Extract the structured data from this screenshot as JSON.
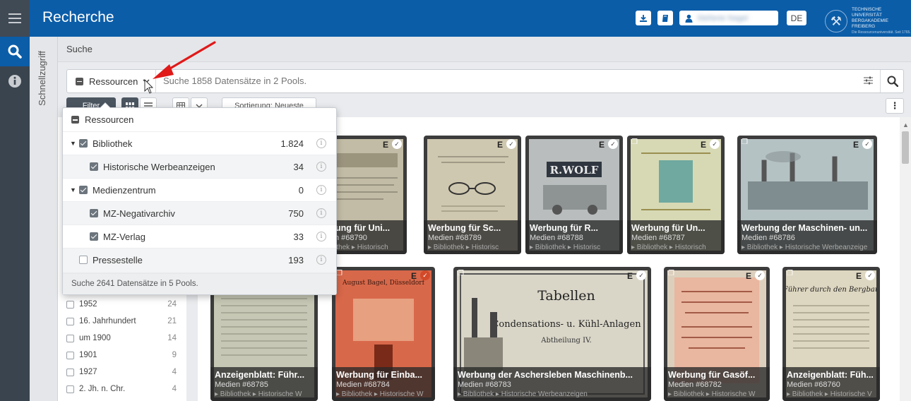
{
  "app": {
    "title": "Recherche"
  },
  "header": {
    "download_icon": "download-icon",
    "book_icon": "book-icon",
    "user_icon": "user-icon",
    "user_name": "Stefanie Nagel",
    "language": "DE",
    "university": {
      "line1": "TECHNISCHE UNIVERSITÄT",
      "line2": "BERGAKADEMIE FREIBERG",
      "line3": "Die Ressourcenuniversität. Seit 1765."
    }
  },
  "sidebar": {
    "quick_access": "Schnellzugriff"
  },
  "search": {
    "section_title": "Suche",
    "resource_label": "Ressourcen",
    "placeholder": "Suche 1858 Datensätze in 2 Pools.",
    "sort_label": "Sortierung: Neueste",
    "filter_label": "Filter"
  },
  "dropdown": {
    "header": "Ressourcen",
    "items": [
      {
        "label": "Bibliothek",
        "count": "1.824",
        "checked": true,
        "expandable": true,
        "level": 0
      },
      {
        "label": "Historische Werbeanzeigen",
        "count": "34",
        "checked": true,
        "expandable": false,
        "level": 1
      },
      {
        "label": "Medienzentrum",
        "count": "0",
        "checked": true,
        "expandable": true,
        "level": 0
      },
      {
        "label": "MZ-Negativarchiv",
        "count": "750",
        "checked": true,
        "expandable": false,
        "level": 1
      },
      {
        "label": "MZ-Verlag",
        "count": "33",
        "checked": true,
        "expandable": false,
        "level": 1
      },
      {
        "label": "Pressestelle",
        "count": "193",
        "checked": false,
        "expandable": false,
        "level": 0
      }
    ],
    "footer": "Suche 2641 Datensätze in 5 Pools."
  },
  "filters": {
    "items": [
      {
        "label": "1952",
        "count": "24"
      },
      {
        "label": "16. Jahrhundert",
        "count": "21"
      },
      {
        "label": "um 1900",
        "count": "14"
      },
      {
        "label": "1901",
        "count": "9"
      },
      {
        "label": "1927",
        "count": "4"
      },
      {
        "label": "2. Jh. n. Chr.",
        "count": "4"
      }
    ]
  },
  "cards_row1": [
    {
      "title": "Werbung für Uni...",
      "sub": "Medien #68790",
      "path": "▸ Bibliothek ▸ Historisch"
    },
    {
      "title": "Werbung für Sc...",
      "sub": "Medien #68789",
      "path": "▸ Bibliothek ▸ Historisc"
    },
    {
      "title": "Werbung für R...",
      "sub": "Medien #68788",
      "path": "▸ Bibliothek ▸ Historisc"
    },
    {
      "title": "Werbung für Un...",
      "sub": "Medien #68787",
      "path": "▸ Bibliothek ▸ Historisch"
    },
    {
      "title": "Werbung der Maschinen- un...",
      "sub": "Medien #68786",
      "path": "▸ Bibliothek ▸ Historische Werbeanzeige"
    }
  ],
  "cards_row2": [
    {
      "title": "Anzeigenblatt: Führ...",
      "sub": "Medien #68785",
      "path": "▸ Bibliothek ▸ Historische W"
    },
    {
      "title": "Werbung für Einba...",
      "sub": "Medien #68784",
      "path": "▸ Bibliothek ▸ Historische W"
    },
    {
      "title": "Werbung der Aschersleben Maschinenb...",
      "sub": "Medien #68783",
      "path": "▸ Bibliothek ▸ Historische Werbeanzeigen"
    },
    {
      "title": "Werbung für Gasöf...",
      "sub": "Medien #68782",
      "path": "▸ Bibliothek ▸ Historische W"
    },
    {
      "title": "Anzeigenblatt: Füh...",
      "sub": "Medien #68760",
      "path": "▸ Bibliothek ▸ Historische V"
    }
  ],
  "card_badges": {
    "edit": "E",
    "check": "✓"
  },
  "thumb_texts": {
    "t1": "Tabellen",
    "t2": "Condensations- u. Kühl-Anlagen",
    "t3": "Abtheilung IV.",
    "t4": "R.WOLF",
    "t5": "Führer durch den Bergbau",
    "t6": "August Bagel, Düsseldorf"
  },
  "colors": {
    "brand": "#0b5da8",
    "nav": "#3a444f",
    "annotation": "#e01919"
  }
}
